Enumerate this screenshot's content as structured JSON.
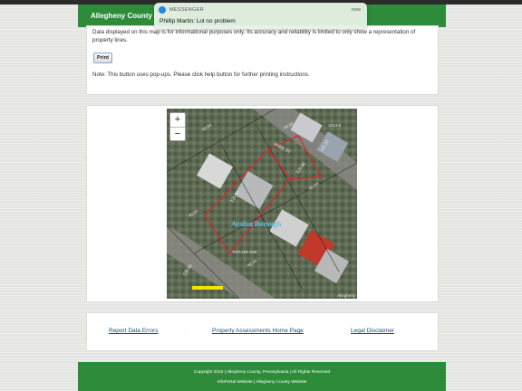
{
  "header": {
    "title": "Allegheny County Real Es"
  },
  "print_panel": {
    "text": "Data displayed on this map is for informational purposes only. Its accuracy and reliability is limited to only show a representation of property lines.",
    "print_label": "Print",
    "note": "Note: This button uses pop-ups. Please click help button for further printing instructions."
  },
  "map": {
    "zoom_in": "+",
    "zoom_out": "−",
    "owner_label": "Avalon Borough",
    "attribution": "Allegheny"
  },
  "links": {
    "report": "Report Data Errors",
    "home": "Property Assessments Home Page",
    "legal": "Legal Disclaimer"
  },
  "footer": {
    "line1": "Copyright 2015 | Allegheny County, Pennsylvania | All Rights Reserved",
    "line2": "InfoPortal Website | Allegheny County Website"
  },
  "notification": {
    "app": "MESSENGER",
    "time": "now",
    "message": "Phillip Martin: Lol no problem"
  },
  "colors": {
    "header_green": "#2e8b3a",
    "parcel_outline": "#e0202a",
    "link_blue": "#1a4a8a"
  }
}
